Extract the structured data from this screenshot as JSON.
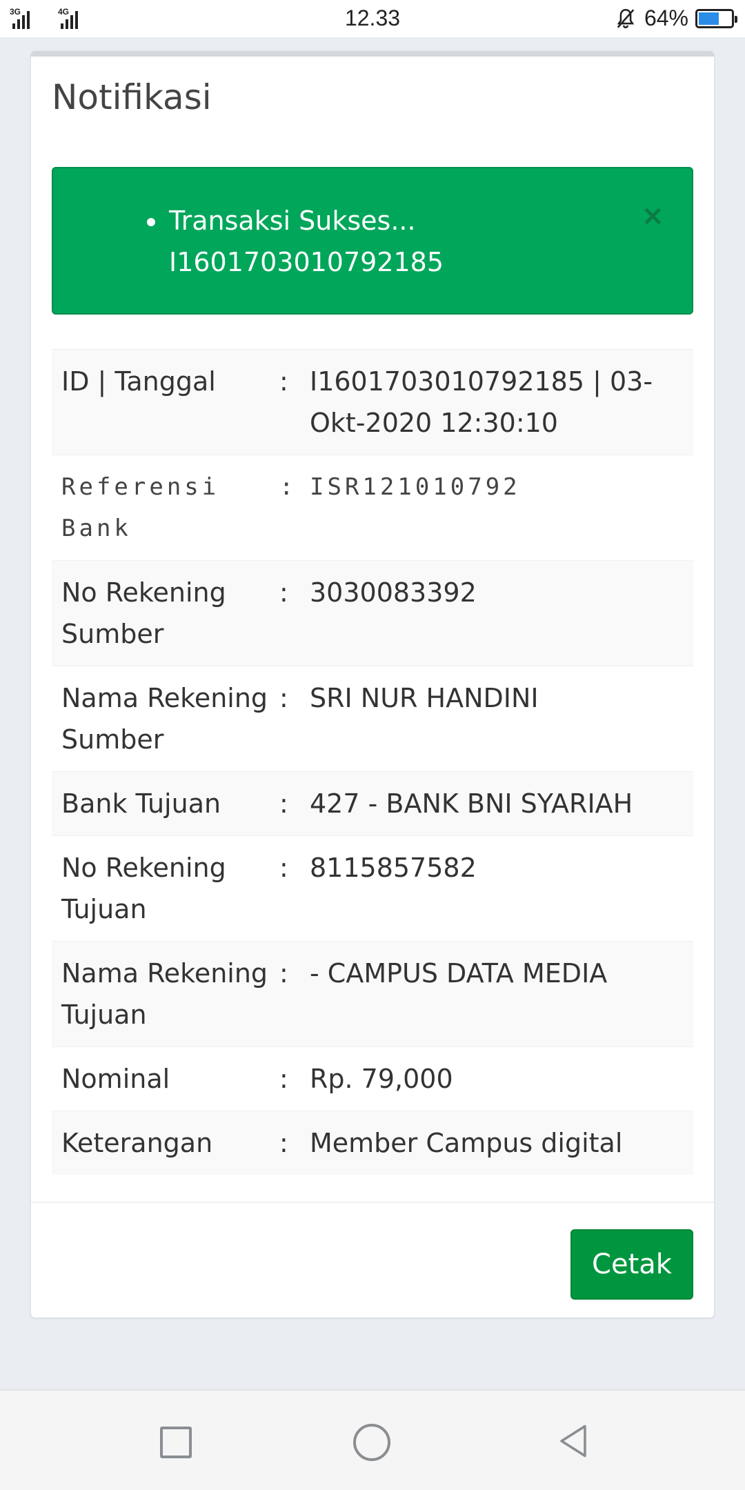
{
  "status_bar": {
    "network_1": "3G",
    "network_2": "4G",
    "time": "12.33",
    "battery_percent": "64%",
    "battery_level": 0.64,
    "icons": [
      "signal-icon",
      "signal-icon",
      "mute-bell-icon",
      "battery-icon"
    ]
  },
  "card": {
    "title": "Notifikasi"
  },
  "alert": {
    "lines": [
      "Transaksi Sukses...",
      "I1601703010792185"
    ],
    "close_symbol": "×",
    "color": "#00a65a"
  },
  "details": [
    {
      "label": "ID | Tanggal",
      "sep": ":",
      "value": "I1601703010792185 | 03-Okt-2020 12:30:10"
    },
    {
      "label": "Referensi Bank",
      "sep": ":",
      "value": "ISR121010792"
    },
    {
      "label": "No Rekening Sumber",
      "sep": ":",
      "value": "3030083392"
    },
    {
      "label": "Nama Rekening Sumber",
      "sep": ":",
      "value": "SRI NUR HANDINI"
    },
    {
      "label": "Bank Tujuan",
      "sep": ":",
      "value": "427 - BANK BNI SYARIAH"
    },
    {
      "label": "No Rekening Tujuan",
      "sep": ":",
      "value": "8115857582"
    },
    {
      "label": "Nama Rekening Tujuan",
      "sep": ":",
      "value": "- CAMPUS DATA MEDIA"
    },
    {
      "label": "Nominal",
      "sep": ":",
      "value": "Rp. 79,000"
    },
    {
      "label": "Keterangan",
      "sep": ":",
      "value": "Member Campus digital"
    }
  ],
  "footer": {
    "print_label": "Cetak",
    "button_color": "#00963f"
  },
  "nav_bar": {
    "icons": [
      "recent-apps-icon",
      "home-icon",
      "back-icon"
    ]
  }
}
